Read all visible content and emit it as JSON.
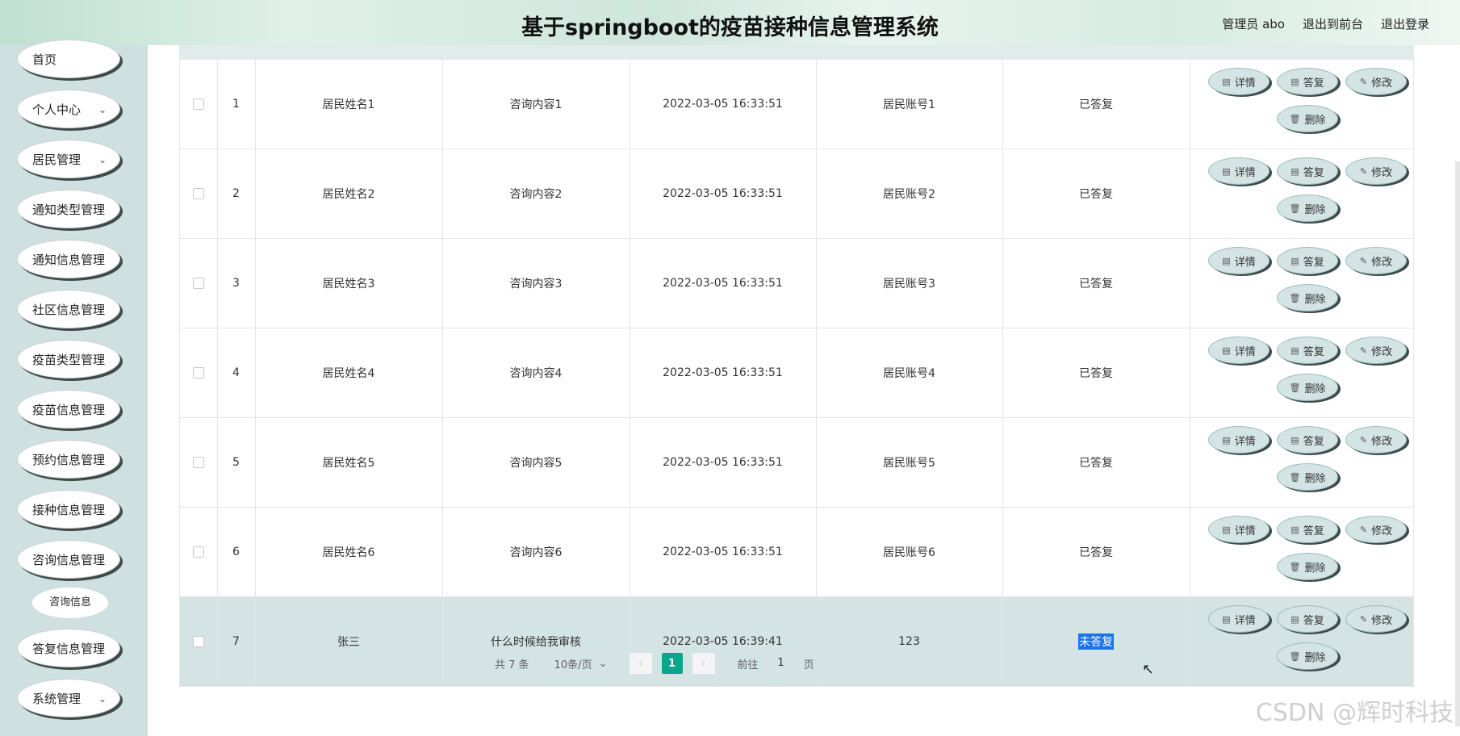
{
  "header": {
    "title": "基于springboot的疫苗接种信息管理系统",
    "user": "管理员 abo",
    "to_front": "退出到前台",
    "logout": "退出登录"
  },
  "sidebar": {
    "items": [
      {
        "label": "首页"
      },
      {
        "label": "个人中心",
        "chevron": "⌄"
      },
      {
        "label": "居民管理",
        "chevron": "⌄"
      },
      {
        "label": "通知类型管理"
      },
      {
        "label": "通知信息管理"
      },
      {
        "label": "社区信息管理"
      },
      {
        "label": "疫苗类型管理"
      },
      {
        "label": "疫苗信息管理"
      },
      {
        "label": "预约信息管理"
      },
      {
        "label": "接种信息管理"
      },
      {
        "label": "咨询信息管理"
      },
      {
        "label": "答复信息管理"
      },
      {
        "label": "系统管理",
        "chevron": "⌄"
      }
    ],
    "submenu": "咨询信息"
  },
  "ops": {
    "detail": "详情",
    "reply": "答复",
    "edit": "修改",
    "delete": "删除"
  },
  "rows": [
    {
      "idx": "1",
      "name": "居民姓名1",
      "content": "咨询内容1",
      "time": "2022-03-05 16:33:51",
      "account": "居民账号1",
      "status": "已答复"
    },
    {
      "idx": "2",
      "name": "居民姓名2",
      "content": "咨询内容2",
      "time": "2022-03-05 16:33:51",
      "account": "居民账号2",
      "status": "已答复"
    },
    {
      "idx": "3",
      "name": "居民姓名3",
      "content": "咨询内容3",
      "time": "2022-03-05 16:33:51",
      "account": "居民账号3",
      "status": "已答复"
    },
    {
      "idx": "4",
      "name": "居民姓名4",
      "content": "咨询内容4",
      "time": "2022-03-05 16:33:51",
      "account": "居民账号4",
      "status": "已答复"
    },
    {
      "idx": "5",
      "name": "居民姓名5",
      "content": "咨询内容5",
      "time": "2022-03-05 16:33:51",
      "account": "居民账号5",
      "status": "已答复"
    },
    {
      "idx": "6",
      "name": "居民姓名6",
      "content": "咨询内容6",
      "time": "2022-03-05 16:33:51",
      "account": "居民账号6",
      "status": "已答复"
    },
    {
      "idx": "7",
      "name": "张三",
      "content": "什么时候给我审核",
      "time": "2022-03-05 16:39:41",
      "account": "123",
      "status": "未答复"
    }
  ],
  "pager": {
    "total": "共 7 条",
    "page_size": "10条/页",
    "current": "1",
    "goto_prefix": "前往",
    "goto_value": "1",
    "goto_suffix": "页"
  },
  "watermark": "CSDN @辉时科技",
  "colors": {
    "accent": "#0aa58a",
    "sidebar": "#cfe0e0",
    "highlight_row": "#d4e3e3"
  }
}
